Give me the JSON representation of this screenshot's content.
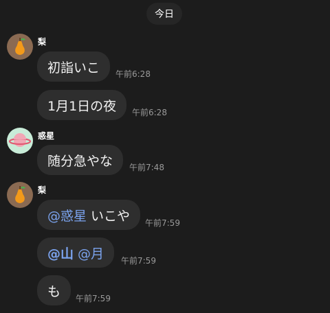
{
  "date_divider": "今日",
  "users": {
    "pear": {
      "name": "梨",
      "avatar_icon": "pear-icon"
    },
    "planet": {
      "name": "惑星",
      "avatar_icon": "planet-icon"
    }
  },
  "messages": [
    {
      "sender": "梨",
      "text": "初詣いこ",
      "time": "午前6:28"
    },
    {
      "sender": "梨",
      "text": "1月1日の夜",
      "time": "午前6:28"
    },
    {
      "sender": "惑星",
      "text": "随分急やな",
      "time": "午前7:48"
    },
    {
      "sender": "梨",
      "mention": "@惑星",
      "text": "いこや",
      "time": "午前7:59"
    },
    {
      "sender": "梨",
      "mention_bold": "@山",
      "mention": "@月",
      "time": "午前7:59"
    },
    {
      "sender": "梨",
      "text": "も",
      "time": "午前7:59"
    }
  ],
  "colors": {
    "background": "#1c1c1c",
    "bubble": "#2e2e2e",
    "mention": "#7ba3ee",
    "timestamp": "#9a9a9a"
  }
}
